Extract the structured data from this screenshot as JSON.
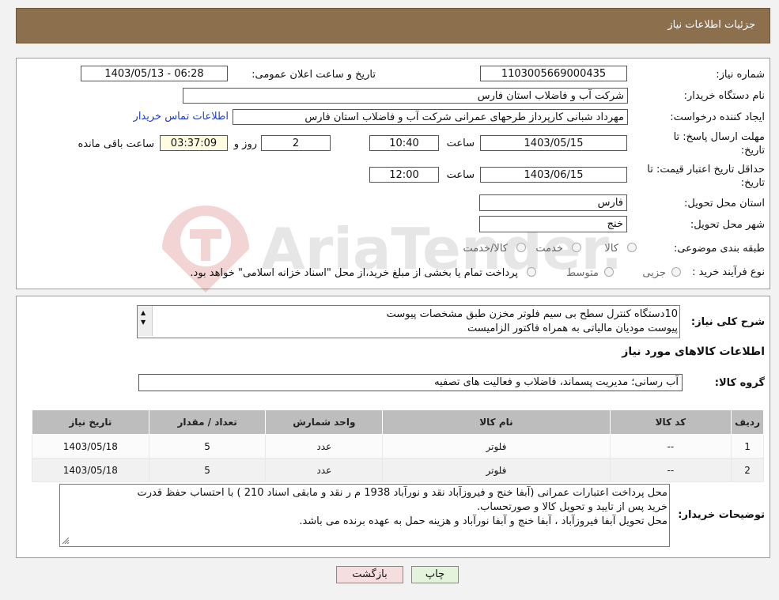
{
  "header": {
    "title": "جزئیات اطلاعات نیاز"
  },
  "watermark": {
    "text": "AriaTender.neT"
  },
  "form": {
    "need_number_label": "شماره نیاز:",
    "need_number": "1103005669000435",
    "announce_label": "تاریخ و ساعت اعلان عمومی:",
    "announce_value": "1403/05/13 - 06:28",
    "buyer_org_label": "نام دستگاه خریدار:",
    "buyer_org": "شرکت آب و فاضلاب استان فارس",
    "requester_label": "ایجاد کننده درخواست:",
    "requester": "مهرداد شبانی کارپرداز طرحهای عمرانی  شرکت آب و فاضلاب استان فارس",
    "contact_link": "اطلاعات تماس خریدار",
    "deadline_label_1": "مهلت ارسال پاسخ: تا",
    "deadline_label_2": "تاریخ:",
    "deadline_date": "1403/05/15",
    "time_label": "ساعت",
    "deadline_time": "10:40",
    "days_value": "2",
    "days_label": "روز و",
    "remaining_time": "03:37:09",
    "remaining_label": "ساعت باقی مانده",
    "validity_label_1": "حداقل تاریخ اعتبار قیمت: تا",
    "validity_label_2": "تاریخ:",
    "validity_date": "1403/06/15",
    "validity_time": "12:00",
    "province_label": "استان محل تحویل:",
    "province": "فارس",
    "city_label": "شهر محل تحویل:",
    "city": "خنج",
    "category_label": "طبقه بندی موضوعی:",
    "category_options": [
      "کالا",
      "خدمت",
      "کالا/خدمت"
    ],
    "process_label": "نوع فرآیند خرید :",
    "process_options": [
      "جزیی",
      "متوسط"
    ],
    "payment_note": "پرداخت تمام یا بخشی از مبلغ خرید،از محل \"اسناد خزانه اسلامی\" خواهد بود."
  },
  "summary": {
    "label": "شرح کلی نیاز:",
    "line1": "10دستگاه کنترل سطح بی سیم فلوتر مخزن طبق مشخصات پیوست",
    "line2": "پیوست مودیان مالیاتی به همراه فاکتور الزامیست"
  },
  "goods": {
    "section_title": "اطلاعات کالاهای مورد نیاز",
    "group_label": "گروه کالا:",
    "group_value": "آب رسانی؛ مدیریت پسماند، فاضلاب و فعالیت های تصفیه",
    "columns": [
      "ردیف",
      "کد کالا",
      "نام کالا",
      "واحد شمارش",
      "تعداد / مقدار",
      "تاریخ نیاز"
    ],
    "rows": [
      [
        "1",
        "--",
        "فلوتر",
        "عدد",
        "5",
        "1403/05/18"
      ],
      [
        "2",
        "--",
        "فلوتر",
        "عدد",
        "5",
        "1403/05/18"
      ]
    ]
  },
  "notes": {
    "label": "توضیحات خریدار:",
    "line1": "محل پرداخت اعتبارات عمرانی (آبفا خنج و فیروزآباد نقد و نورآباد 1938 م ر نقد و مابقی اسناد 210 )  با احتساب حفظ قدرت",
    "line2": "خرید پس از تایید و تحویل کالا و صورتحساب.",
    "line3": "محل تحویل آبفا فیروزآباد ، آبفا خنج و آبفا نورآباد    و هزینه حمل به عهده برنده می باشد."
  },
  "buttons": {
    "print": "چاپ",
    "back": "بازگشت"
  },
  "colors": {
    "header_bg": "#8c6f4c",
    "link": "#1f3ccc",
    "back_button_bg": "#f6dede",
    "print_button_bg": "#e4f4dc"
  },
  "icons": [
    "scroll-up-icon",
    "scroll-down-icon",
    "resize-grip-icon",
    "radio-icon"
  ]
}
